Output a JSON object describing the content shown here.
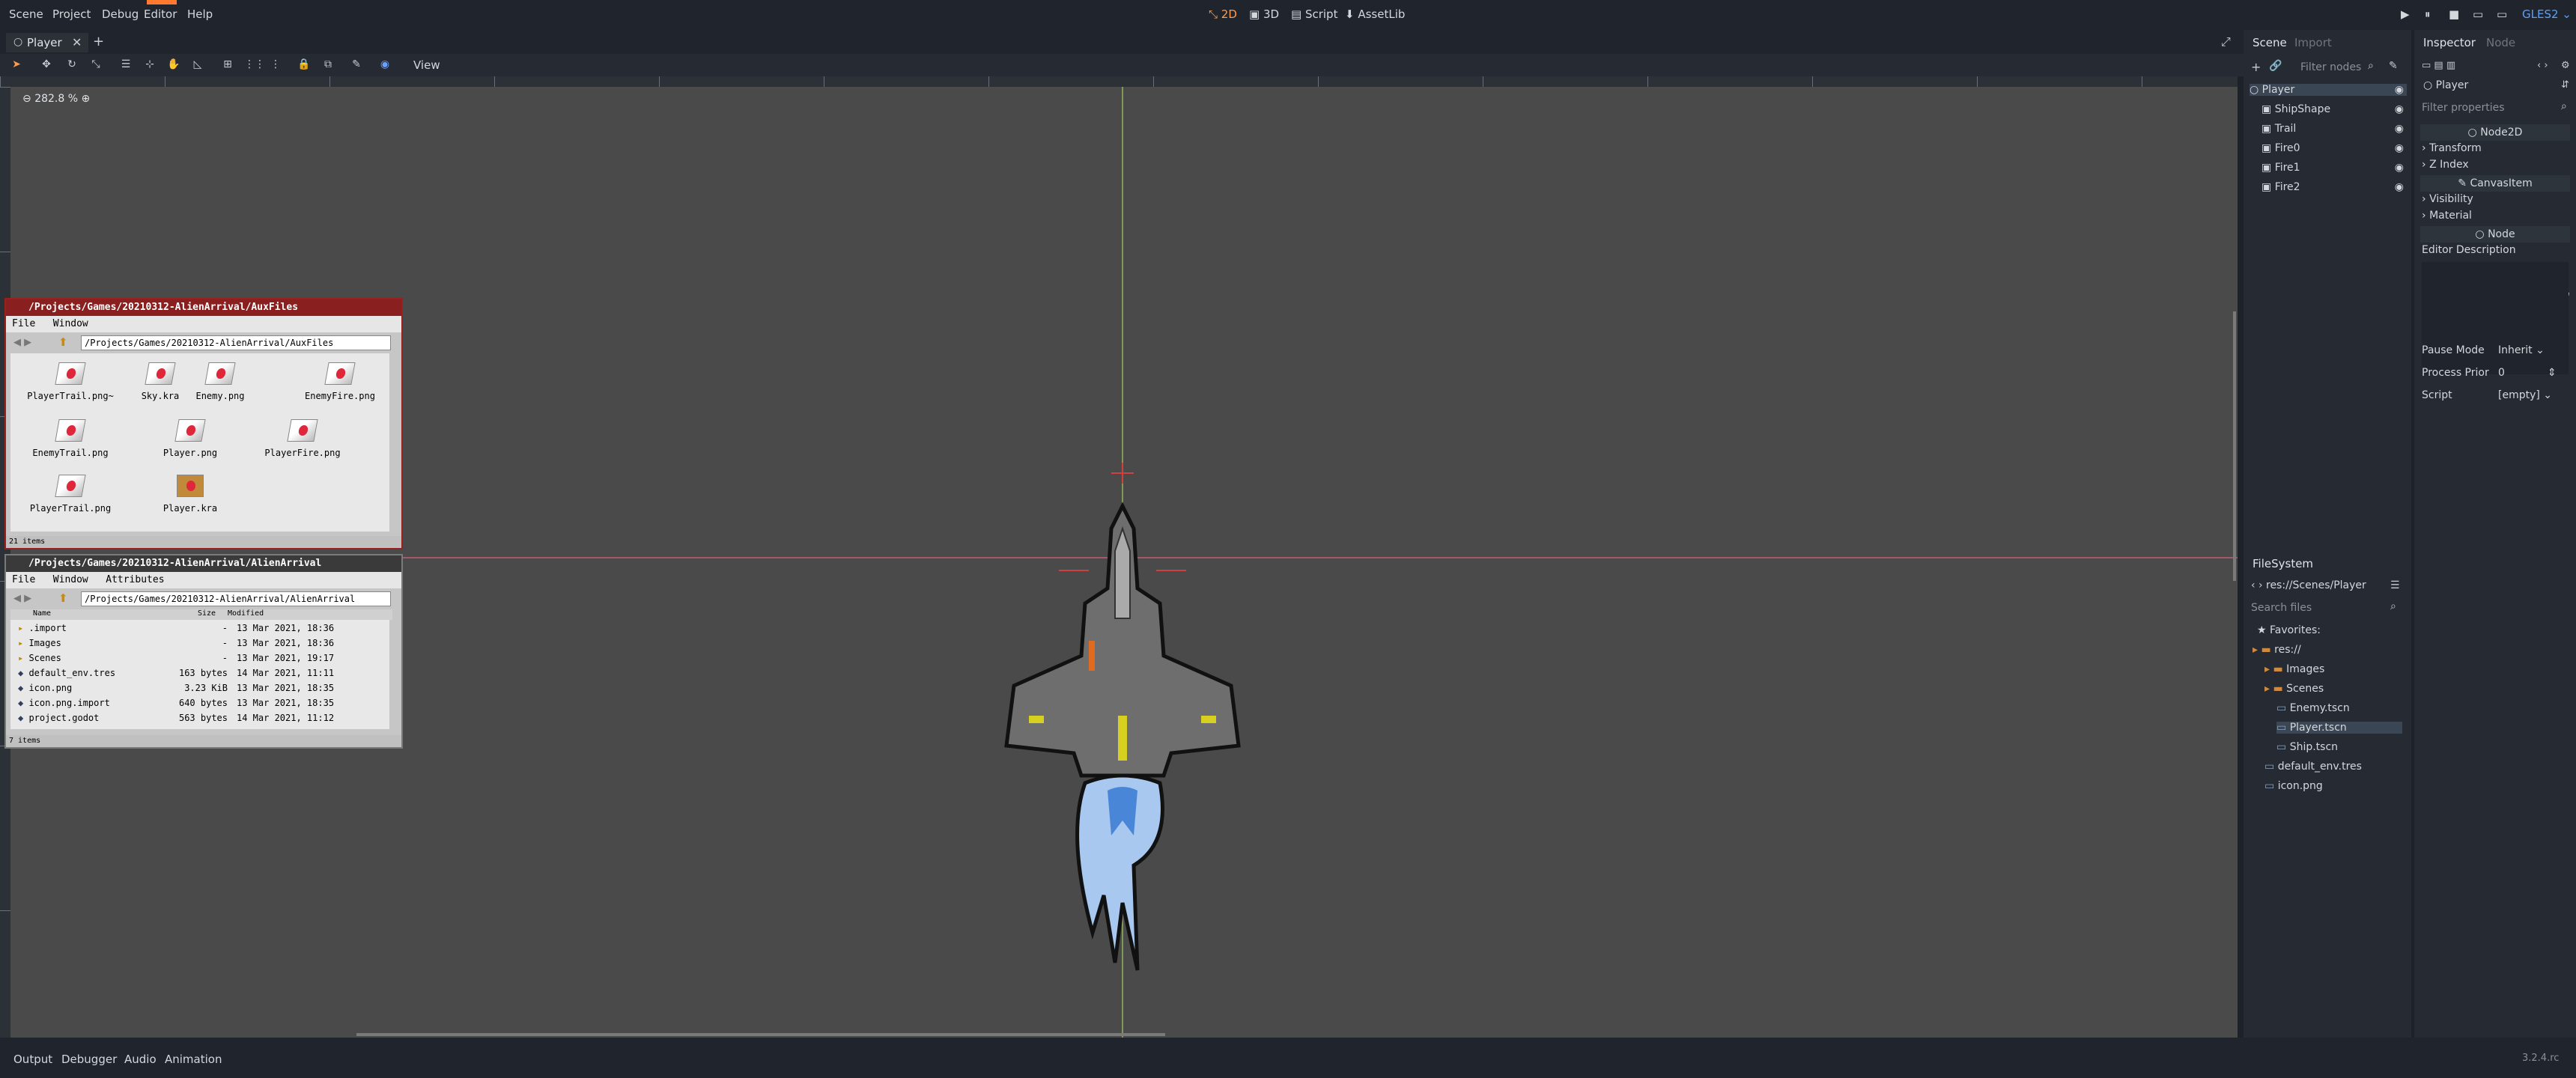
{
  "menubar": {
    "items": [
      "Scene",
      "Project",
      "Debug",
      "Editor",
      "Help"
    ],
    "modes": [
      "2D",
      "3D",
      "Script",
      "AssetLib"
    ],
    "renderer": "GLES2"
  },
  "scene_tab": {
    "label": "Player"
  },
  "toolbar": {
    "view_label": "View"
  },
  "viewport": {
    "zoom": "282.8 %"
  },
  "bottom": {
    "tabs": [
      "Output",
      "Debugger",
      "Audio",
      "Animation"
    ],
    "version": "3.2.4.rc"
  },
  "scene_dock": {
    "tabs": [
      "Scene",
      "Import"
    ],
    "filter_placeholder": "Filter nodes",
    "nodes": [
      {
        "label": "Player",
        "level": 0
      },
      {
        "label": "ShipShape",
        "level": 1
      },
      {
        "label": "Trail",
        "level": 1
      },
      {
        "label": "Fire0",
        "level": 1
      },
      {
        "label": "Fire1",
        "level": 1
      },
      {
        "label": "Fire2",
        "level": 1
      }
    ]
  },
  "filesystem": {
    "title": "FileSystem",
    "path": "res://Scenes/Player",
    "search_placeholder": "Search files",
    "favorites": "Favorites:",
    "items": [
      {
        "label": "res://",
        "level": 0
      },
      {
        "label": "Images",
        "level": 1
      },
      {
        "label": "Scenes",
        "level": 1
      },
      {
        "label": "Enemy.tscn",
        "level": 2
      },
      {
        "label": "Player.tscn",
        "level": 2,
        "selected": true
      },
      {
        "label": "Ship.tscn",
        "level": 2
      },
      {
        "label": "default_env.tres",
        "level": 1
      },
      {
        "label": "icon.png",
        "level": 1
      }
    ]
  },
  "inspector": {
    "tabs": [
      "Inspector",
      "Node"
    ],
    "object": "Player",
    "filter_placeholder": "Filter properties",
    "sections": [
      "Node2D",
      "CanvasItem",
      "Node"
    ],
    "props": [
      "Transform",
      "Z Index",
      "Visibility",
      "Material"
    ],
    "editor_description": "Editor Description",
    "pause_mode_label": "Pause Mode",
    "pause_mode_value": "Inherit",
    "process_prior_label": "Process Prior",
    "process_prior_value": "0",
    "script_label": "Script",
    "script_value": "[empty]"
  },
  "fm1": {
    "title": "/Projects/Games/20210312-AlienArrival/AuxFiles",
    "menu": [
      "File",
      "Window"
    ],
    "path": "/Projects/Games/20210312-AlienArrival/AuxFiles",
    "files": [
      "PlayerTrail.png~",
      "Sky.kra",
      "Enemy.png",
      "EnemyFire.png",
      "EnemyTrail.png",
      "Player.png",
      "PlayerFire.png",
      "PlayerTrail.png",
      "Player.kra"
    ],
    "status": "21 items"
  },
  "fm2": {
    "title": "/Projects/Games/20210312-AlienArrival/AlienArrival",
    "menu": [
      "File",
      "Window",
      "Attributes"
    ],
    "path": "/Projects/Games/20210312-AlienArrival/AlienArrival",
    "headers": [
      "Name",
      "Size",
      "Modified"
    ],
    "rows": [
      {
        "name": ".import",
        "size": "-",
        "modified": "13 Mar 2021, 18:36"
      },
      {
        "name": "Images",
        "size": "-",
        "modified": "13 Mar 2021, 18:36"
      },
      {
        "name": "Scenes",
        "size": "-",
        "modified": "13 Mar 2021, 19:17"
      },
      {
        "name": "default_env.tres",
        "size": "163 bytes",
        "modified": "14 Mar 2021, 11:11"
      },
      {
        "name": "icon.png",
        "size": "3.23 KiB",
        "modified": "13 Mar 2021, 18:35"
      },
      {
        "name": "icon.png.import",
        "size": "640 bytes",
        "modified": "13 Mar 2021, 18:35"
      },
      {
        "name": "project.godot",
        "size": "563 bytes",
        "modified": "14 Mar 2021, 11:12"
      }
    ],
    "status": "7 items"
  },
  "colors": {
    "accent": "#ff9b4a",
    "ship": "#6e6e6e",
    "flame": "#a8c8f0"
  }
}
